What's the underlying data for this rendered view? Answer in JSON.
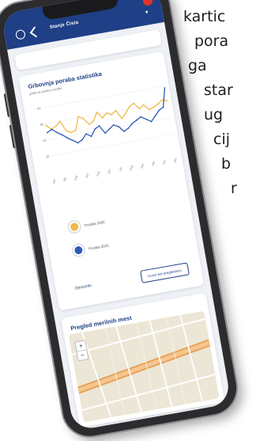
{
  "side_text": [
    "kartic",
    "pora",
    "ga",
    "star",
    "ug",
    "cij",
    "b",
    "r"
  ],
  "app": {
    "title": "Stanje Čista",
    "header_icons": [
      "settings-icon",
      "back-icon"
    ]
  },
  "chart_card": {
    "title": "Grbovnja poraba statistika",
    "subtitle": "grafa za analizo porabe"
  },
  "chart_data": {
    "type": "line",
    "title": "Grbovnja poraba statistika",
    "series": [
      {
        "name": "Poraba 2020",
        "color": "#f2b84a",
        "values": [
          58,
          52,
          55,
          60,
          47,
          44,
          46,
          62,
          58,
          50,
          53,
          63,
          55,
          60,
          57,
          61,
          50,
          56,
          63,
          66,
          58,
          62,
          55,
          57,
          60,
          64,
          62
        ]
      },
      {
        "name": "Poraba 2021",
        "color": "#2e5bb8",
        "values": [
          49,
          52,
          47,
          43,
          38,
          34,
          30,
          33,
          39,
          35,
          43,
          46,
          36,
          40,
          44,
          41,
          34,
          37,
          42,
          45,
          48,
          44,
          40,
          46,
          52,
          55,
          78
        ]
      }
    ],
    "ylim": [
      0,
      80
    ],
    "y_ticks": [
      "80",
      "60",
      "40",
      "20"
    ],
    "x_ticks": [
      "jan",
      "feb",
      "mar",
      "apr",
      "maj",
      "jun",
      "jul",
      "avg",
      "sep",
      "okt",
      "nov",
      "dec"
    ]
  },
  "legend": [
    {
      "label": "Poraba 2020",
      "color": "#f2b84a"
    },
    {
      "label": "Poraba 2021",
      "color": "#2e5bb8"
    }
  ],
  "actions": {
    "link_label": "Opozorilo",
    "button_label": "Izvozi kot preglednico"
  },
  "map_card": {
    "title": "Pregled merilnih mest",
    "zoom_in": "+",
    "zoom_out": "−"
  }
}
